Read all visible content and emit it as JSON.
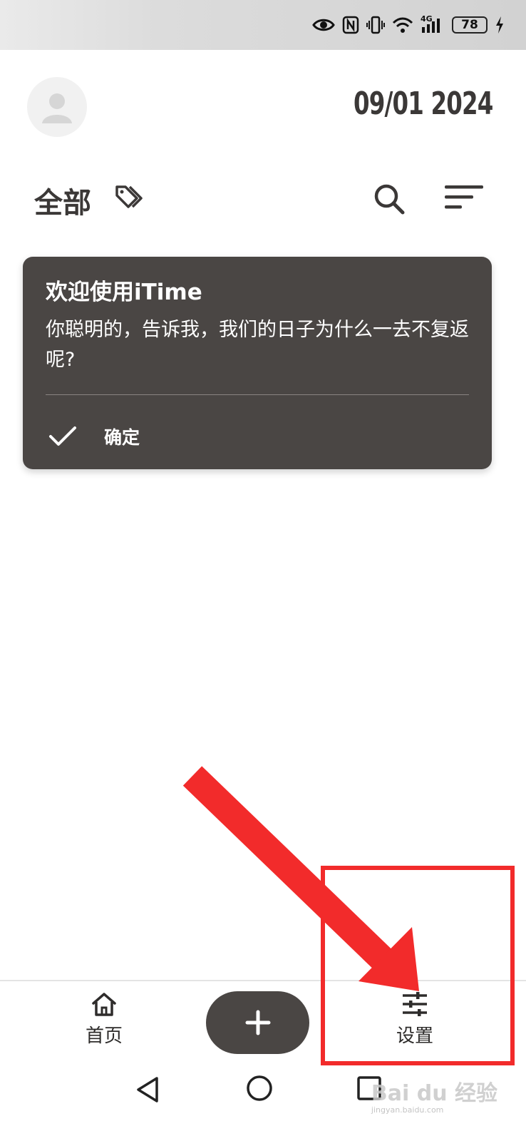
{
  "status_bar": {
    "battery": "78",
    "network": "4G"
  },
  "header": {
    "date": "09/01 2024"
  },
  "filter": {
    "title": "全部"
  },
  "welcome_card": {
    "title": "欢迎使用iTime",
    "body": "你聪明的，告诉我，我们的日子为什么一去不复返呢?",
    "confirm_label": "确定"
  },
  "bottom_nav": {
    "home_label": "首页",
    "settings_label": "设置"
  },
  "watermark": {
    "brand": "Bai du 经验",
    "url": "jingyan.baidu.com"
  },
  "colors": {
    "card": "#4a4644",
    "text_dark": "#2e2c2b",
    "annotation_red": "#f22b2b",
    "fab": "#4a4644"
  },
  "icons": [
    "eye-icon",
    "nfc-icon",
    "vibrate-icon",
    "wifi-icon",
    "signal-icon",
    "charging-icon",
    "avatar-icon",
    "tag-icon",
    "search-icon",
    "sort-icon",
    "check-icon",
    "home-icon",
    "plus-icon",
    "settings-sliders-icon",
    "back-icon",
    "circle-home-icon",
    "square-recent-icon"
  ]
}
